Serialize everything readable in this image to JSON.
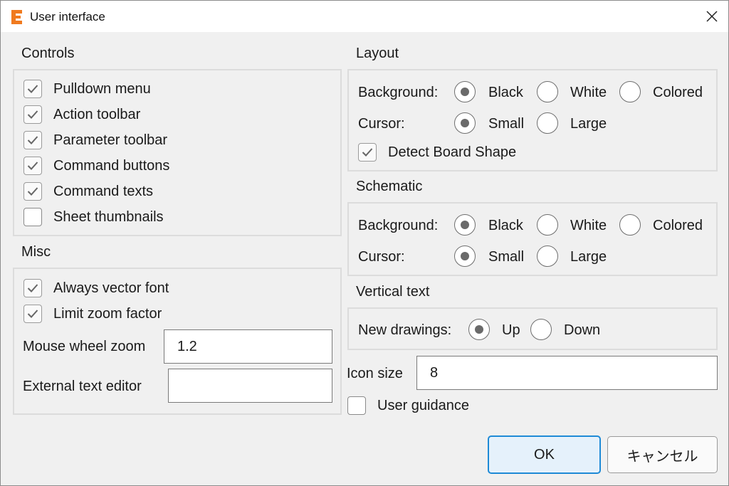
{
  "window": {
    "title": "User interface"
  },
  "controls": {
    "title": "Controls",
    "items": [
      {
        "label": "Pulldown menu",
        "checked": true
      },
      {
        "label": "Action toolbar",
        "checked": true
      },
      {
        "label": "Parameter toolbar",
        "checked": true
      },
      {
        "label": "Command buttons",
        "checked": true
      },
      {
        "label": "Command texts",
        "checked": true
      },
      {
        "label": "Sheet thumbnails",
        "checked": false
      }
    ]
  },
  "misc": {
    "title": "Misc",
    "always_vector_font": {
      "label": "Always vector font",
      "checked": true
    },
    "limit_zoom_factor": {
      "label": "Limit zoom factor",
      "checked": true
    },
    "mouse_wheel_zoom": {
      "label": "Mouse wheel zoom",
      "value": "1.2"
    },
    "external_text_editor": {
      "label": "External text editor",
      "value": ""
    }
  },
  "layout": {
    "title": "Layout",
    "background_label": "Background:",
    "background_options": [
      "Black",
      "White",
      "Colored"
    ],
    "background_selected": "Black",
    "cursor_label": "Cursor:",
    "cursor_options": [
      "Small",
      "Large"
    ],
    "cursor_selected": "Small",
    "detect_board_shape": {
      "label": "Detect Board Shape",
      "checked": true
    }
  },
  "schematic": {
    "title": "Schematic",
    "background_label": "Background:",
    "background_options": [
      "Black",
      "White",
      "Colored"
    ],
    "background_selected": "Black",
    "cursor_label": "Cursor:",
    "cursor_options": [
      "Small",
      "Large"
    ],
    "cursor_selected": "Small"
  },
  "vertical_text": {
    "title": "Vertical text",
    "new_drawings_label": "New drawings:",
    "options": [
      "Up",
      "Down"
    ],
    "selected": "Up"
  },
  "icon_size": {
    "label": "Icon size",
    "value": "8"
  },
  "user_guidance": {
    "label": "User guidance",
    "checked": false
  },
  "buttons": {
    "ok": "OK",
    "cancel": "キャンセル"
  },
  "colors": {
    "accent": "#1e8ad6",
    "app_icon": "#f07a1f",
    "background": "#f0f0f0"
  },
  "icons": {
    "app": "eagle-e-icon",
    "close": "close-icon",
    "check": "check-icon"
  }
}
